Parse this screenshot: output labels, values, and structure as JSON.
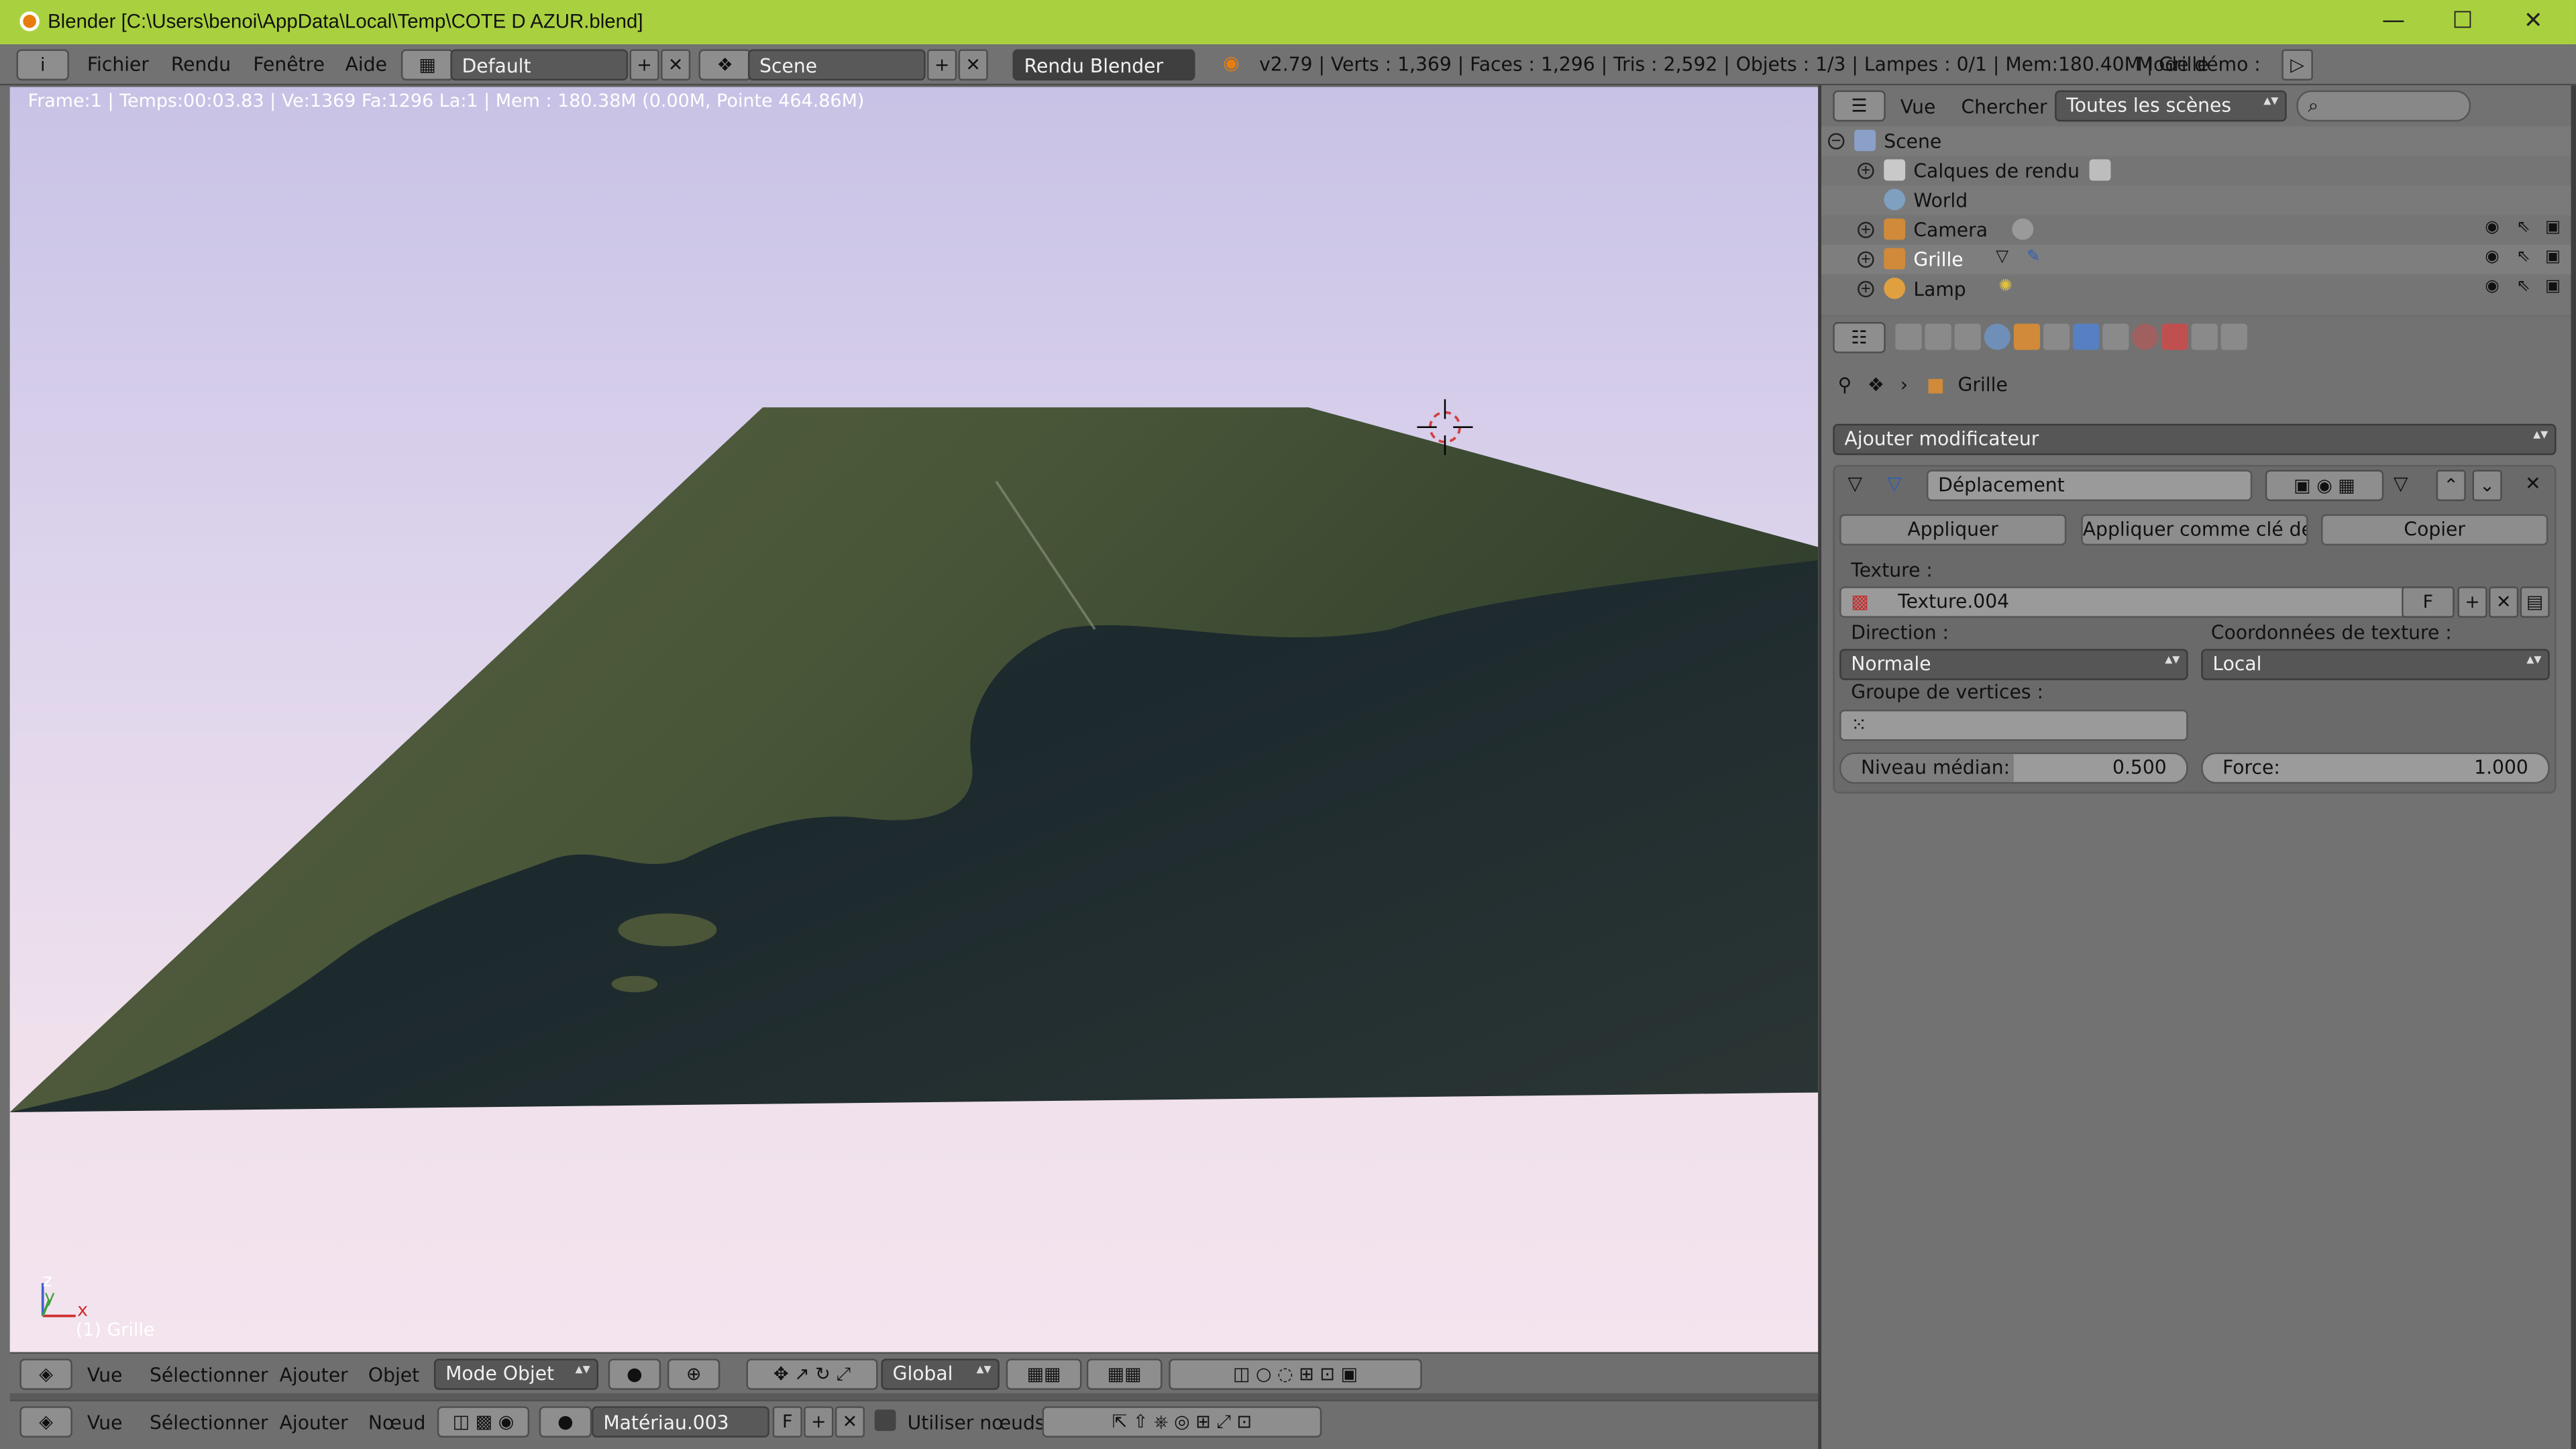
{
  "window": {
    "title": "Blender [C:\\Users\\benoi\\AppData\\Local\\Temp\\COTE D AZUR.blend]",
    "minimize": "—",
    "maximize": "☐",
    "close": "✕"
  },
  "menu": {
    "info_icon": "i",
    "items": [
      "Fichier",
      "Rendu",
      "Fenêtre",
      "Aide"
    ],
    "layout": "Default",
    "scene": "Scene",
    "engine": "Rendu Blender",
    "stats": "v2.79 | Verts : 1,369 | Faces : 1,296 | Tris : 2,592 | Objets : 1/3 | Lampes : 0/1 | Mem:180.40M | Grille",
    "demo_mode": "Mode démo :"
  },
  "viewport": {
    "info": "Frame:1 | Temps:00:03.83 | Ve:1369 Fa:1296 La:1 | Mem : 180.38M (0.00M, Pointe 464.86M)",
    "object_name": "(1) Grille",
    "axis_z": "z",
    "axis_y": "y",
    "axis_x": "x",
    "colors": {
      "sea": "#1f2c30",
      "land": "#3d4a30",
      "horizon": "#f3e4ee"
    }
  },
  "view3d_header": {
    "items": [
      "Vue",
      "Sélectionner",
      "Ajouter",
      "Objet"
    ],
    "mode": "Mode Objet",
    "orientation": "Global"
  },
  "node_header": {
    "items": [
      "Vue",
      "Sélectionner",
      "Ajouter",
      "Nœud"
    ],
    "material": "Matériau.003",
    "fake_user": "F",
    "use_nodes": "Utiliser nœuds"
  },
  "outliner": {
    "menu": [
      "Vue",
      "Chercher"
    ],
    "display_mode": "Toutes les scènes",
    "rows": [
      {
        "label": "Scene"
      },
      {
        "label": "Calques de rendu"
      },
      {
        "label": "World"
      },
      {
        "label": "Camera"
      },
      {
        "label": "Grille"
      },
      {
        "label": "Lamp"
      }
    ]
  },
  "properties": {
    "breadcrumb": "Grille",
    "add_modifier": "Ajouter modificateur",
    "modifier": {
      "name": "Déplacement",
      "apply": "Appliquer",
      "apply_as_key": "Appliquer comme clé de f...",
      "copy": "Copier",
      "texture_label": "Texture :",
      "texture": "Texture.004",
      "texture_f": "F",
      "direction_label": "Direction :",
      "direction": "Normale",
      "coords_label": "Coordonnées de texture :",
      "coords": "Local",
      "vgroup_label": "Groupe de vertices :",
      "midlevel_label": "Niveau médian:",
      "midlevel": "0.500",
      "midlevel_fraction": 0.5,
      "strength_label": "Force:",
      "strength": "1.000"
    }
  }
}
